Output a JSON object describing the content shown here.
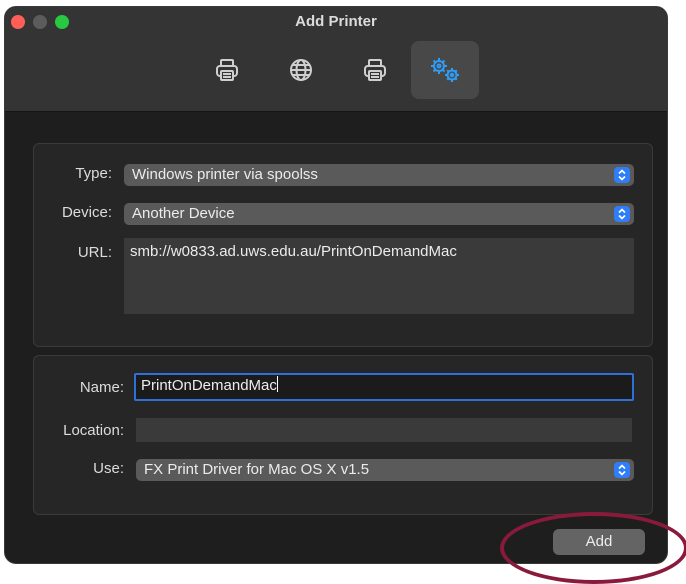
{
  "window": {
    "title": "Add Printer"
  },
  "toolbar": {
    "tools": [
      {
        "icon": "printer-icon"
      },
      {
        "icon": "globe-icon"
      },
      {
        "icon": "printer-icon"
      },
      {
        "icon": "gears-icon",
        "selected": true
      }
    ]
  },
  "connection": {
    "type_label": "Type:",
    "type_value": "Windows printer via spoolss",
    "device_label": "Device:",
    "device_value": "Another Device",
    "url_label": "URL:",
    "url_value": "smb://w0833.ad.uws.edu.au/PrintOnDemandMac"
  },
  "details": {
    "name_label": "Name:",
    "name_value": "PrintOnDemandMac",
    "location_label": "Location:",
    "location_value": "",
    "use_label": "Use:",
    "use_value": "FX Print Driver for Mac OS X v1.5"
  },
  "footer": {
    "add_label": "Add"
  },
  "colors": {
    "accent": "#2f7ef6",
    "annotation": "#8a1a3c"
  }
}
